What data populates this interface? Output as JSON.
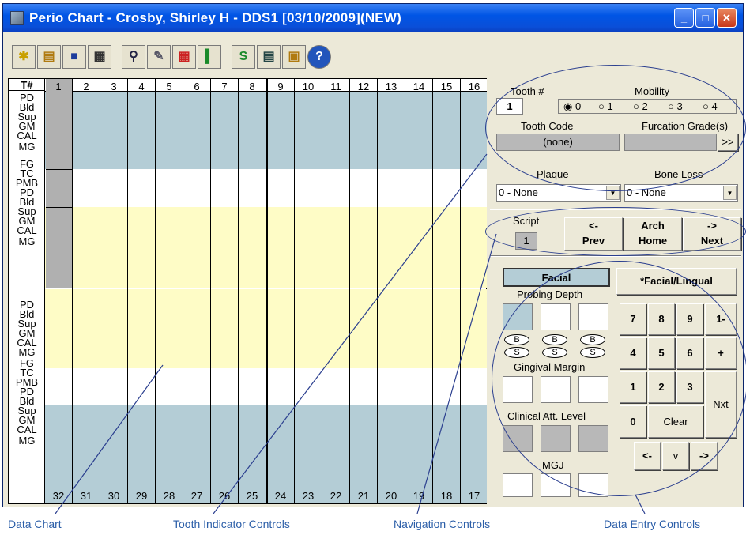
{
  "window": {
    "title": "Perio Chart - Crosby, Shirley H - DDS1 [03/10/2009](NEW)",
    "min": "_",
    "max": "□",
    "close": "✕"
  },
  "toolbar": {
    "icons": [
      "new-icon",
      "open-icon",
      "save-icon",
      "print-icon",
      "zoom-icon",
      "tools-icon",
      "calendar-icon",
      "exit-icon",
      "s-icon",
      "list-icon",
      "folder-info-icon",
      "help-icon"
    ],
    "glyphs": [
      "✱",
      "▤",
      "■",
      "▦",
      "⚲",
      "✎",
      "▦",
      "▌",
      "S",
      "▤",
      "▣",
      "?"
    ]
  },
  "chart": {
    "header_label": "T#",
    "top_teeth": [
      "1",
      "2",
      "3",
      "4",
      "5",
      "6",
      "7",
      "8",
      "9",
      "10",
      "11",
      "12",
      "13",
      "14",
      "15",
      "16"
    ],
    "bottom_teeth": [
      "32",
      "31",
      "30",
      "29",
      "28",
      "27",
      "26",
      "25",
      "24",
      "23",
      "22",
      "21",
      "20",
      "19",
      "18",
      "17"
    ],
    "row_labels": {
      "g1": [
        "PD",
        "Bld",
        "Sup",
        "GM",
        "CAL",
        "MG"
      ],
      "g2": [
        "FG",
        "TC",
        "PMB"
      ],
      "g3": [
        "PD",
        "Bld",
        "Sup",
        "GM",
        "CAL",
        "MG"
      ],
      "g4": [
        "PD",
        "Bld",
        "Sup",
        "GM",
        "CAL",
        "MG"
      ],
      "g5": [
        "FG",
        "TC",
        "PMB"
      ],
      "g6": [
        "PD",
        "Bld",
        "Sup",
        "GM",
        "CAL",
        "MG"
      ]
    },
    "colors": {
      "blue": "#b4cdd6",
      "yellow": "#fefcc6",
      "gray": "#b0b0b0"
    }
  },
  "tooth_panel": {
    "tooth_label": "Tooth #",
    "tooth_value": "1",
    "mobility_label": "Mobility",
    "mobility_options": [
      "0",
      "1",
      "2",
      "3",
      "4"
    ],
    "tooth_code_label": "Tooth Code",
    "tooth_code_value": "(none)",
    "furcation_label": "Furcation Grade(s)",
    "furcation_btn": ">>",
    "plaque_label": "Plaque",
    "plaque_value": "0 - None",
    "bone_loss_label": "Bone Loss",
    "bone_loss_value": "0 - None"
  },
  "nav_panel": {
    "script_label": "Script",
    "script_value": "1",
    "prev_arrow": "<-",
    "prev": "Prev",
    "arch": "Arch",
    "home": "Home",
    "next_arrow": "->",
    "next": "Next"
  },
  "entry_panel": {
    "facial": "Facial",
    "facial_lingual": "*Facial/Lingual",
    "probing": "Probing Depth",
    "b": "B",
    "s": "S",
    "gingival": "Gingival Margin",
    "cal": "Clinical Att. Level",
    "mgj": "MGJ",
    "keys": [
      "7",
      "8",
      "9",
      "1-",
      "4",
      "5",
      "6",
      "+",
      "1",
      "2",
      "3",
      "Nxt",
      "0",
      "Clear",
      "<-",
      "v",
      "->"
    ]
  },
  "callouts": {
    "data_chart": "Data Chart",
    "tooth_controls": "Tooth Indicator Controls",
    "nav_controls": "Navigation Controls",
    "entry_controls": "Data Entry Controls"
  }
}
